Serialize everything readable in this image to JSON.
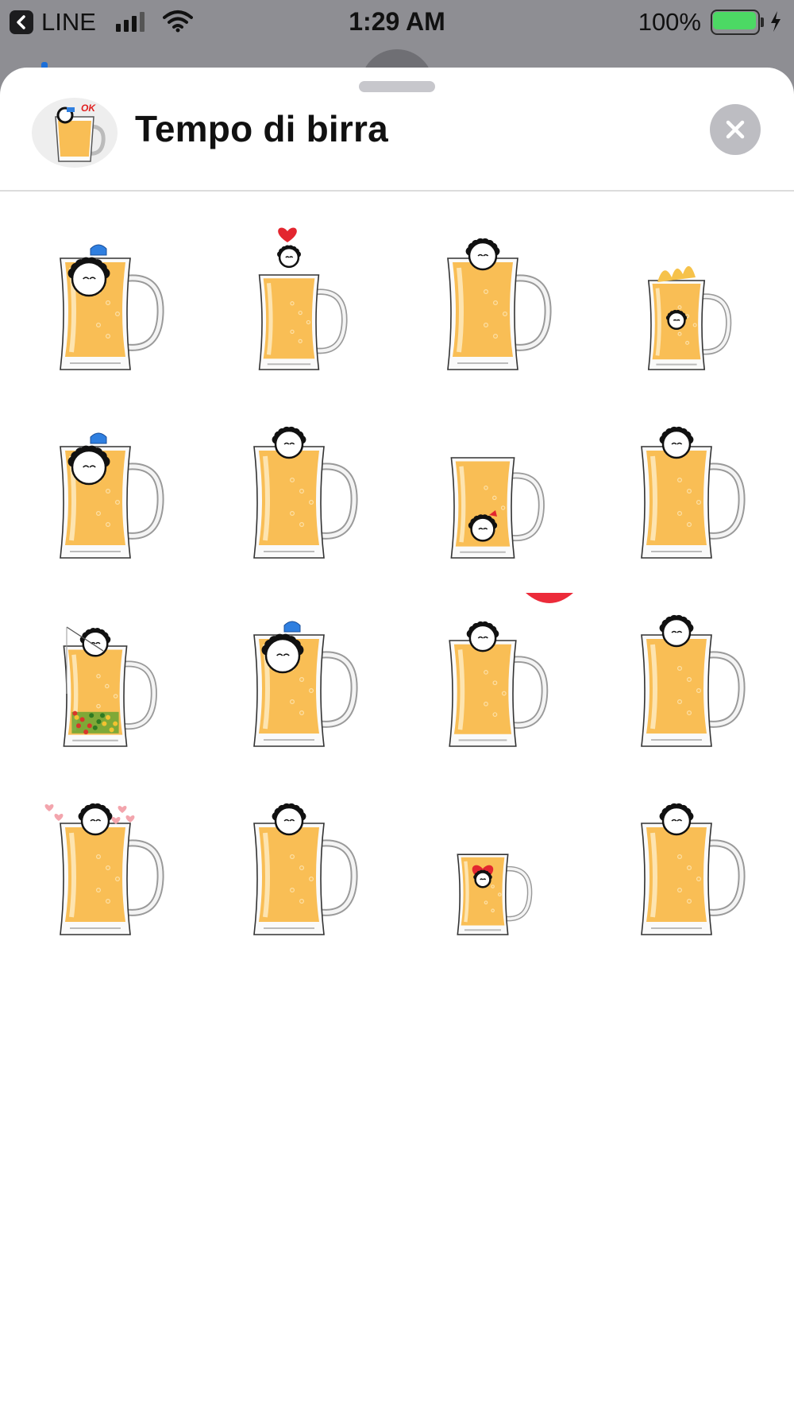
{
  "status_bar": {
    "back_app": "LINE",
    "time": "1:29 AM",
    "battery": "100%",
    "battery_level": 1.0,
    "battery_color": "#4cd964"
  },
  "sheet": {
    "title": "Tempo di birra",
    "pack_icon_text": "OK"
  },
  "stickers": [
    {
      "id": 1,
      "name": "mug-character-blue-hat-upside",
      "scale": 1.0,
      "top": "blue-hat",
      "inside": "upside"
    },
    {
      "id": 2,
      "name": "mug-character-love",
      "scale": 0.85,
      "top": "love",
      "inside": "none"
    },
    {
      "id": 3,
      "name": "mug-character-peeking",
      "scale": 1.0,
      "top": "head",
      "inside": "none"
    },
    {
      "id": 4,
      "name": "mug-character-splash",
      "scale": 0.8,
      "top": "splash",
      "inside": "face"
    },
    {
      "id": 5,
      "name": "mug-character-blue-hat-upside-2",
      "scale": 1.0,
      "top": "blue-hat",
      "inside": "upside"
    },
    {
      "id": 6,
      "name": "mug-character-peeking-2",
      "scale": 1.0,
      "top": "head",
      "inside": "none"
    },
    {
      "id": 7,
      "name": "mug-character-bow-bottom",
      "scale": 0.9,
      "top": "none",
      "inside": "bottom"
    },
    {
      "id": 8,
      "name": "mug-character-peeking-3",
      "scale": 1.0,
      "top": "head",
      "inside": "none"
    },
    {
      "id": 9,
      "name": "mug-character-fishing-salad",
      "scale": 0.9,
      "top": "fishing",
      "inside": "salad"
    },
    {
      "id": 10,
      "name": "mug-character-blue-hat-upside-3",
      "scale": 1.0,
      "top": "blue-hat",
      "inside": "upside"
    },
    {
      "id": 11,
      "name": "mug-character-red-balloon",
      "scale": 0.95,
      "top": "head-balloon",
      "inside": "none"
    },
    {
      "id": 12,
      "name": "mug-character-peeking-4",
      "scale": 1.0,
      "top": "head",
      "inside": "none"
    },
    {
      "id": 13,
      "name": "mug-character-hearts",
      "scale": 1.0,
      "top": "hearts",
      "inside": "none"
    },
    {
      "id": 14,
      "name": "mug-character-peeking-5",
      "scale": 1.0,
      "top": "head",
      "inside": "none"
    },
    {
      "id": 15,
      "name": "mug-character-red-heart-small",
      "scale": 0.72,
      "top": "none",
      "inside": "heart"
    },
    {
      "id": 16,
      "name": "mug-character-peeking-6",
      "scale": 1.0,
      "top": "head",
      "inside": "none"
    }
  ]
}
